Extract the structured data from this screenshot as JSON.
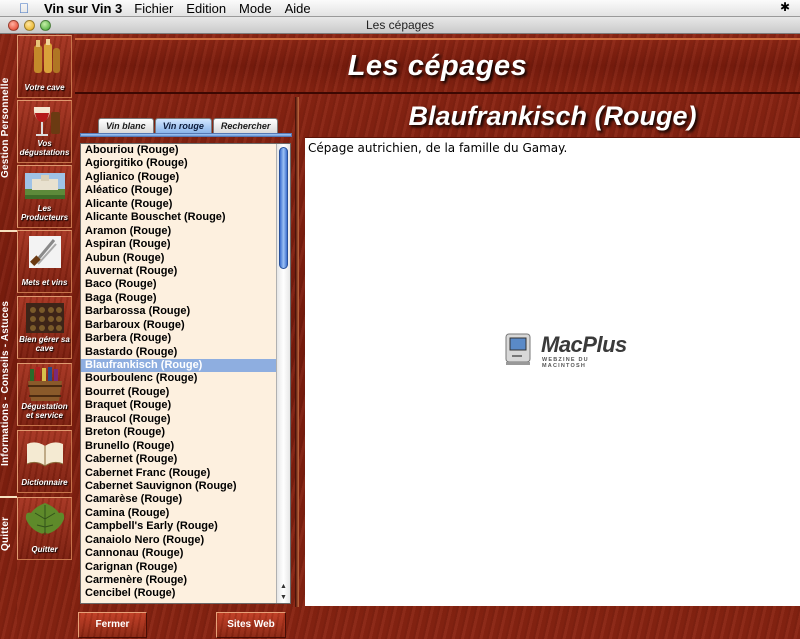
{
  "menubar": {
    "app_name": "Vin sur Vin 3",
    "items": [
      "Fichier",
      "Edition",
      "Mode",
      "Aide"
    ]
  },
  "window": {
    "title": "Les cépages"
  },
  "rail": {
    "labels": [
      "Gestion Personnelle",
      "Informations - Conseils - Astuces",
      "Quitter"
    ]
  },
  "sidebar": {
    "buttons": [
      {
        "name": "votre-cave",
        "label": "Votre cave"
      },
      {
        "name": "vos-degustations",
        "label": "Vos dégustations"
      },
      {
        "name": "les-producteurs",
        "label": "Les Producteurs"
      },
      {
        "name": "mets-et-vins",
        "label": "Mets et vins"
      },
      {
        "name": "bien-gerer-sa-cave",
        "label": "Bien gérer sa cave"
      },
      {
        "name": "degustation-et-service",
        "label": "Dégustation et service"
      },
      {
        "name": "dictionnaire",
        "label": "Dictionnaire"
      },
      {
        "name": "quitter",
        "label": "Quitter"
      }
    ]
  },
  "header": {
    "title": "Les cépages"
  },
  "tabs": [
    "Vin blanc",
    "Vin rouge",
    "Rechercher"
  ],
  "active_tab": "Vin rouge",
  "list": {
    "items": [
      "Abouriou (Rouge)",
      "Agiorgitiko (Rouge)",
      "Aglianico (Rouge)",
      "Aléatico (Rouge)",
      "Alicante (Rouge)",
      "Alicante Bouschet (Rouge)",
      "Aramon (Rouge)",
      "Aspiran (Rouge)",
      "Aubun (Rouge)",
      "Auvernat (Rouge)",
      "Baco (Rouge)",
      "Baga (Rouge)",
      "Barbarossa (Rouge)",
      "Barbaroux (Rouge)",
      "Barbera (Rouge)",
      "Bastardo (Rouge)",
      "Blaufrankisch (Rouge)",
      "Bourboulenc (Rouge)",
      "Bourret (Rouge)",
      "Braquet (Rouge)",
      "Braucol (Rouge)",
      "Breton (Rouge)",
      "Brunello (Rouge)",
      "Cabernet (Rouge)",
      "Cabernet Franc (Rouge)",
      "Cabernet Sauvignon (Rouge)",
      "Camarèse (Rouge)",
      "Camina (Rouge)",
      "Campbell's Early (Rouge)",
      "Canaiolo Nero (Rouge)",
      "Cannonau (Rouge)",
      "Carignan (Rouge)",
      "Carmenère (Rouge)",
      "Cencibel (Rouge)"
    ],
    "selected_index": 16
  },
  "detail": {
    "title": "Blaufrankisch (Rouge)",
    "description": "Cépage autrichien, de la famille du Gamay."
  },
  "logo": {
    "brand": "MacPlus",
    "tagline": "WEBZINE DU MACINTOSH"
  },
  "buttons": {
    "close": "Fermer",
    "websites": "Sites Web"
  }
}
